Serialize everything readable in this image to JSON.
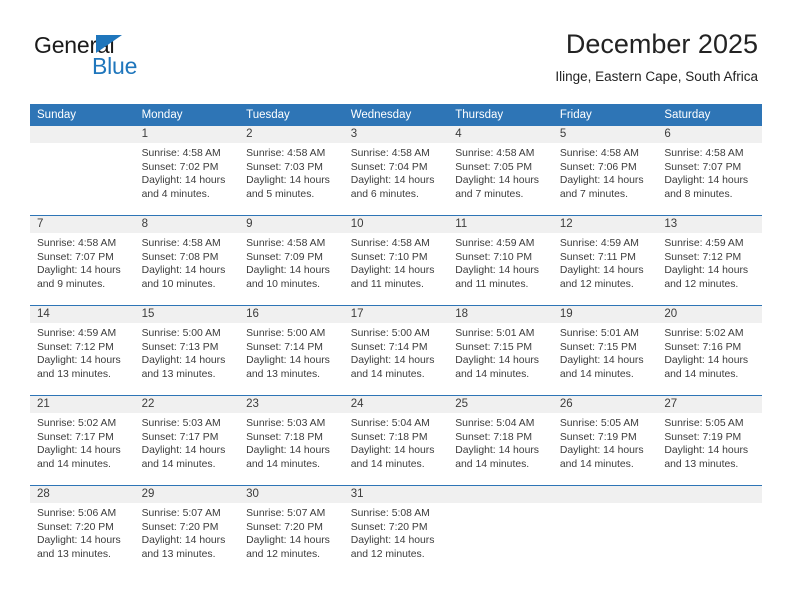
{
  "logo": {
    "word_one": "General",
    "word_two": "Blue",
    "triangle_color": "#1f76bc",
    "icon": "general-blue-logo"
  },
  "header": {
    "title": "December 2025",
    "subtitle": "Ilinge, Eastern Cape, South Africa"
  },
  "colors": {
    "header_band": "#2e75b6",
    "daynum_band": "#f0f0f0",
    "text": "#3c3c3c",
    "accent": "#1f76bc"
  },
  "weekday_headers": [
    "Sunday",
    "Monday",
    "Tuesday",
    "Wednesday",
    "Thursday",
    "Friday",
    "Saturday"
  ],
  "weeks": [
    [
      {
        "day": "",
        "sunrise": "",
        "sunset": "",
        "daylight1": "",
        "daylight2": "",
        "empty": true
      },
      {
        "day": "1",
        "sunrise": "Sunrise: 4:58 AM",
        "sunset": "Sunset: 7:02 PM",
        "daylight1": "Daylight: 14 hours",
        "daylight2": "and 4 minutes.",
        "empty": false
      },
      {
        "day": "2",
        "sunrise": "Sunrise: 4:58 AM",
        "sunset": "Sunset: 7:03 PM",
        "daylight1": "Daylight: 14 hours",
        "daylight2": "and 5 minutes.",
        "empty": false
      },
      {
        "day": "3",
        "sunrise": "Sunrise: 4:58 AM",
        "sunset": "Sunset: 7:04 PM",
        "daylight1": "Daylight: 14 hours",
        "daylight2": "and 6 minutes.",
        "empty": false
      },
      {
        "day": "4",
        "sunrise": "Sunrise: 4:58 AM",
        "sunset": "Sunset: 7:05 PM",
        "daylight1": "Daylight: 14 hours",
        "daylight2": "and 7 minutes.",
        "empty": false
      },
      {
        "day": "5",
        "sunrise": "Sunrise: 4:58 AM",
        "sunset": "Sunset: 7:06 PM",
        "daylight1": "Daylight: 14 hours",
        "daylight2": "and 7 minutes.",
        "empty": false
      },
      {
        "day": "6",
        "sunrise": "Sunrise: 4:58 AM",
        "sunset": "Sunset: 7:07 PM",
        "daylight1": "Daylight: 14 hours",
        "daylight2": "and 8 minutes.",
        "empty": false
      }
    ],
    [
      {
        "day": "7",
        "sunrise": "Sunrise: 4:58 AM",
        "sunset": "Sunset: 7:07 PM",
        "daylight1": "Daylight: 14 hours",
        "daylight2": "and 9 minutes.",
        "empty": false
      },
      {
        "day": "8",
        "sunrise": "Sunrise: 4:58 AM",
        "sunset": "Sunset: 7:08 PM",
        "daylight1": "Daylight: 14 hours",
        "daylight2": "and 10 minutes.",
        "empty": false
      },
      {
        "day": "9",
        "sunrise": "Sunrise: 4:58 AM",
        "sunset": "Sunset: 7:09 PM",
        "daylight1": "Daylight: 14 hours",
        "daylight2": "and 10 minutes.",
        "empty": false
      },
      {
        "day": "10",
        "sunrise": "Sunrise: 4:58 AM",
        "sunset": "Sunset: 7:10 PM",
        "daylight1": "Daylight: 14 hours",
        "daylight2": "and 11 minutes.",
        "empty": false
      },
      {
        "day": "11",
        "sunrise": "Sunrise: 4:59 AM",
        "sunset": "Sunset: 7:10 PM",
        "daylight1": "Daylight: 14 hours",
        "daylight2": "and 11 minutes.",
        "empty": false
      },
      {
        "day": "12",
        "sunrise": "Sunrise: 4:59 AM",
        "sunset": "Sunset: 7:11 PM",
        "daylight1": "Daylight: 14 hours",
        "daylight2": "and 12 minutes.",
        "empty": false
      },
      {
        "day": "13",
        "sunrise": "Sunrise: 4:59 AM",
        "sunset": "Sunset: 7:12 PM",
        "daylight1": "Daylight: 14 hours",
        "daylight2": "and 12 minutes.",
        "empty": false
      }
    ],
    [
      {
        "day": "14",
        "sunrise": "Sunrise: 4:59 AM",
        "sunset": "Sunset: 7:12 PM",
        "daylight1": "Daylight: 14 hours",
        "daylight2": "and 13 minutes.",
        "empty": false
      },
      {
        "day": "15",
        "sunrise": "Sunrise: 5:00 AM",
        "sunset": "Sunset: 7:13 PM",
        "daylight1": "Daylight: 14 hours",
        "daylight2": "and 13 minutes.",
        "empty": false
      },
      {
        "day": "16",
        "sunrise": "Sunrise: 5:00 AM",
        "sunset": "Sunset: 7:14 PM",
        "daylight1": "Daylight: 14 hours",
        "daylight2": "and 13 minutes.",
        "empty": false
      },
      {
        "day": "17",
        "sunrise": "Sunrise: 5:00 AM",
        "sunset": "Sunset: 7:14 PM",
        "daylight1": "Daylight: 14 hours",
        "daylight2": "and 14 minutes.",
        "empty": false
      },
      {
        "day": "18",
        "sunrise": "Sunrise: 5:01 AM",
        "sunset": "Sunset: 7:15 PM",
        "daylight1": "Daylight: 14 hours",
        "daylight2": "and 14 minutes.",
        "empty": false
      },
      {
        "day": "19",
        "sunrise": "Sunrise: 5:01 AM",
        "sunset": "Sunset: 7:15 PM",
        "daylight1": "Daylight: 14 hours",
        "daylight2": "and 14 minutes.",
        "empty": false
      },
      {
        "day": "20",
        "sunrise": "Sunrise: 5:02 AM",
        "sunset": "Sunset: 7:16 PM",
        "daylight1": "Daylight: 14 hours",
        "daylight2": "and 14 minutes.",
        "empty": false
      }
    ],
    [
      {
        "day": "21",
        "sunrise": "Sunrise: 5:02 AM",
        "sunset": "Sunset: 7:17 PM",
        "daylight1": "Daylight: 14 hours",
        "daylight2": "and 14 minutes.",
        "empty": false
      },
      {
        "day": "22",
        "sunrise": "Sunrise: 5:03 AM",
        "sunset": "Sunset: 7:17 PM",
        "daylight1": "Daylight: 14 hours",
        "daylight2": "and 14 minutes.",
        "empty": false
      },
      {
        "day": "23",
        "sunrise": "Sunrise: 5:03 AM",
        "sunset": "Sunset: 7:18 PM",
        "daylight1": "Daylight: 14 hours",
        "daylight2": "and 14 minutes.",
        "empty": false
      },
      {
        "day": "24",
        "sunrise": "Sunrise: 5:04 AM",
        "sunset": "Sunset: 7:18 PM",
        "daylight1": "Daylight: 14 hours",
        "daylight2": "and 14 minutes.",
        "empty": false
      },
      {
        "day": "25",
        "sunrise": "Sunrise: 5:04 AM",
        "sunset": "Sunset: 7:18 PM",
        "daylight1": "Daylight: 14 hours",
        "daylight2": "and 14 minutes.",
        "empty": false
      },
      {
        "day": "26",
        "sunrise": "Sunrise: 5:05 AM",
        "sunset": "Sunset: 7:19 PM",
        "daylight1": "Daylight: 14 hours",
        "daylight2": "and 14 minutes.",
        "empty": false
      },
      {
        "day": "27",
        "sunrise": "Sunrise: 5:05 AM",
        "sunset": "Sunset: 7:19 PM",
        "daylight1": "Daylight: 14 hours",
        "daylight2": "and 13 minutes.",
        "empty": false
      }
    ],
    [
      {
        "day": "28",
        "sunrise": "Sunrise: 5:06 AM",
        "sunset": "Sunset: 7:20 PM",
        "daylight1": "Daylight: 14 hours",
        "daylight2": "and 13 minutes.",
        "empty": false
      },
      {
        "day": "29",
        "sunrise": "Sunrise: 5:07 AM",
        "sunset": "Sunset: 7:20 PM",
        "daylight1": "Daylight: 14 hours",
        "daylight2": "and 13 minutes.",
        "empty": false
      },
      {
        "day": "30",
        "sunrise": "Sunrise: 5:07 AM",
        "sunset": "Sunset: 7:20 PM",
        "daylight1": "Daylight: 14 hours",
        "daylight2": "and 12 minutes.",
        "empty": false
      },
      {
        "day": "31",
        "sunrise": "Sunrise: 5:08 AM",
        "sunset": "Sunset: 7:20 PM",
        "daylight1": "Daylight: 14 hours",
        "daylight2": "and 12 minutes.",
        "empty": false
      },
      {
        "day": "",
        "sunrise": "",
        "sunset": "",
        "daylight1": "",
        "daylight2": "",
        "empty": true
      },
      {
        "day": "",
        "sunrise": "",
        "sunset": "",
        "daylight1": "",
        "daylight2": "",
        "empty": true
      },
      {
        "day": "",
        "sunrise": "",
        "sunset": "",
        "daylight1": "",
        "daylight2": "",
        "empty": true
      }
    ]
  ]
}
